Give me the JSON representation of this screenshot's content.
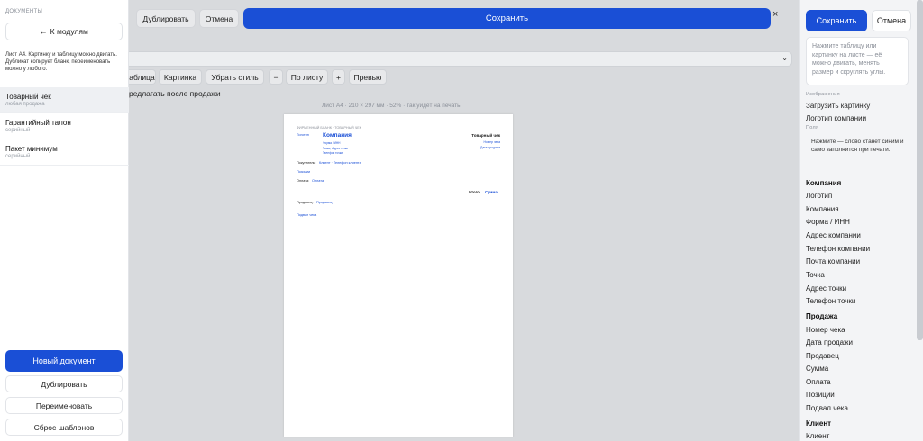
{
  "sidebar": {
    "section_label": "ДОКУМЕНТЫ",
    "back_button": "К модулям",
    "hint": "Лист А4. Картинку и таблицу можно двигать. Дубликат копирует бланк, переименовать можно у любого.",
    "items": [
      {
        "title": "Товарный чек",
        "subtitle": "любая продажа"
      },
      {
        "title": "Гарантийный талон",
        "subtitle": "серийный"
      },
      {
        "title": "Пакет минимум",
        "subtitle": "серийный"
      }
    ],
    "new_document": "Новый документ",
    "duplicate": "Дублировать",
    "rename": "Переименовать",
    "reset_templates": "Сброс шаблонов"
  },
  "toolbar": {
    "duplicate": "Дублировать",
    "cancel": "Отмена",
    "save": "Сохранить",
    "close": "×"
  },
  "format_toolbar": {
    "table": "аблица",
    "picture": "Картинка",
    "clear_style": "Убрать стиль",
    "minus": "−",
    "fit_sheet": "По листу",
    "plus": "+",
    "preview": "Превью"
  },
  "trigger_text": "редлагать после продажи",
  "sheet_info": "Лист А4 · 210 × 297 мм · 52% · так уйдёт на печать",
  "paper": {
    "header_label": "ФИРМЕННЫЙ БЛАНК · ТОВАРНЫЙ ЧЕК",
    "logo": "Логотип",
    "company": "Компания",
    "form_inn": "Форма / ИНН",
    "point_line": "Точка, Адрес точки",
    "phone_point": "Телефон точки",
    "doc_title": "Товарный чек",
    "receipt_no": "Номер чека",
    "sale_date": "Дата продажи",
    "buyer_label": "Покупатель:",
    "buyer_value": "Клиент · Телефон клиента",
    "positions": "Позиции",
    "payment_label": "Оплата:",
    "payment_value": "Оплата",
    "total_label": "Итого:",
    "total_value": "Сумма",
    "seller_label": "Продавец:",
    "seller_value": "Продавец",
    "footer": "Подвал чека"
  },
  "right_panel": {
    "save": "Сохранить",
    "cancel": "Отмена",
    "hint": "Нажмите таблицу или картинку на листе — её можно двигать, менять размер и скруглять углы.",
    "images_caption": "Изображения",
    "upload_picture": "Загрузить картинку",
    "company_logo": "Логотип компании",
    "fields_caption": "Поля",
    "fields_note": "Нажмите — слово станет синим и само заполнится при печати.",
    "groups": [
      {
        "title": "Компания",
        "fields": [
          "Логотип",
          "Компания",
          "Форма / ИНН",
          "Адрес компании",
          "Телефон компании",
          "Почта компании",
          "Точка",
          "Адрес точки",
          "Телефон точки"
        ]
      },
      {
        "title": "Продажа",
        "fields": [
          "Номер чека",
          "Дата продажи",
          "Продавец",
          "Сумма",
          "Оплата",
          "Позиции",
          "Подвал чека"
        ]
      },
      {
        "title": "Клиент",
        "fields": [
          "Клиент"
        ]
      }
    ]
  },
  "colors": {
    "accent": "#1a4fd6",
    "canvas_bg": "#d8dadd",
    "panel_bg": "#f3f4f6"
  }
}
